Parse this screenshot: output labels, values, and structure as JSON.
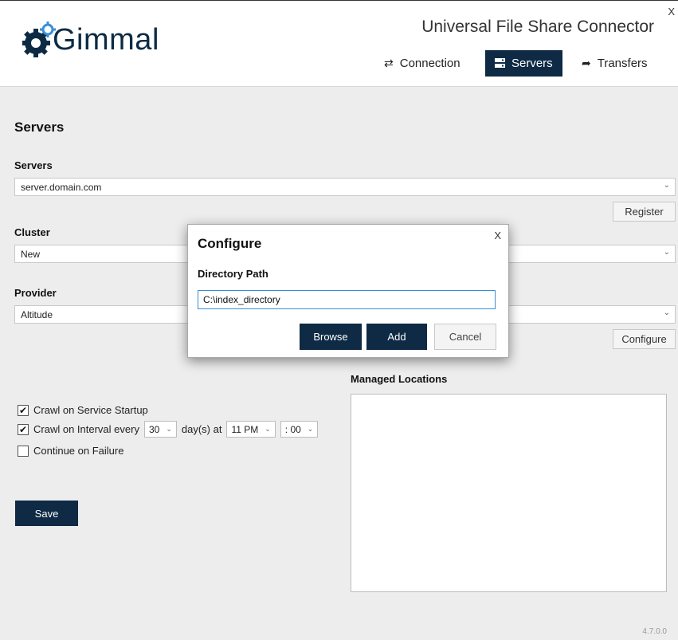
{
  "window": {
    "app_title": "Universal File Share Connector",
    "close_label": "X",
    "version": "4.7.0.0"
  },
  "logo": {
    "text": "Gimmal"
  },
  "nav": {
    "connection": {
      "label": "Connection",
      "icon": "sync-arrows-icon"
    },
    "servers": {
      "label": "Servers",
      "icon": "server-icon"
    },
    "transfers": {
      "label": "Transfers",
      "icon": "share-arrow-icon"
    }
  },
  "main": {
    "heading": "Servers",
    "servers_label": "Servers",
    "servers_value": "server.domain.com",
    "register_label": "Register",
    "cluster_label": "Cluster",
    "cluster_value": "New",
    "provider_label": "Provider",
    "provider_value": "Altitude",
    "configure_label": "Configure",
    "crawl_startup_label": "Crawl on Service Startup",
    "crawl_startup_checked": true,
    "crawl_interval_label": "Crawl on Interval every",
    "crawl_interval_checked": true,
    "interval_value": "30",
    "days_at_label": "day(s) at",
    "hour_value": "11 PM",
    "minute_value": ": 00",
    "continue_failure_label": "Continue on Failure",
    "continue_failure_checked": false,
    "save_label": "Save",
    "managed_locations_label": "Managed Locations"
  },
  "dialog": {
    "title": "Configure",
    "close_label": "X",
    "directory_label": "Directory Path",
    "directory_value": "C:\\index_directory",
    "browse_label": "Browse",
    "add_label": "Add",
    "cancel_label": "Cancel"
  },
  "colors": {
    "accent_dark": "#0e2a44",
    "input_focus": "#3a8fd8",
    "background": "#ededed"
  }
}
